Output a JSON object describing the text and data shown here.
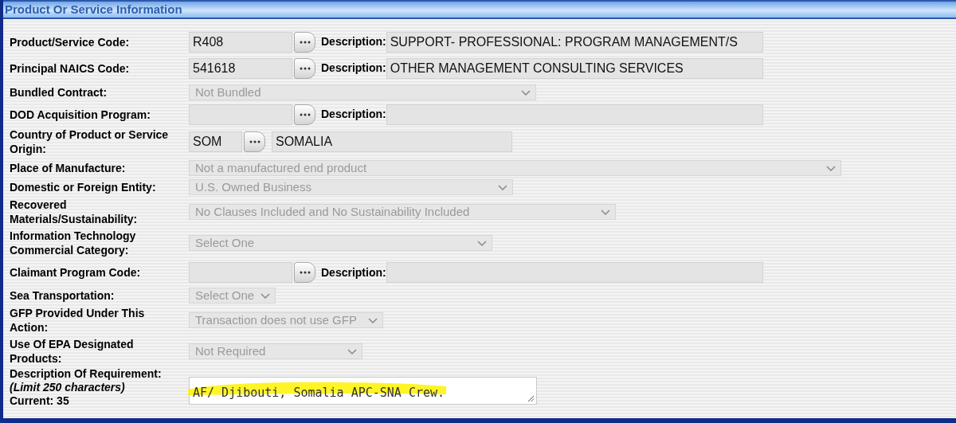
{
  "section": {
    "title": "Product Or Service Information"
  },
  "rows": [
    {
      "kind": "lookup",
      "label": "Product/Service Code:",
      "code": "R408",
      "description_label": "Description:",
      "description": "SUPPORT- PROFESSIONAL: PROGRAM MANAGEMENT/S"
    },
    {
      "kind": "lookup",
      "label": "Principal NAICS Code:",
      "code": "541618",
      "description_label": "Description:",
      "description": "OTHER MANAGEMENT CONSULTING SERVICES"
    },
    {
      "kind": "select",
      "label": "Bundled Contract:",
      "value": "Not Bundled",
      "disabled": true
    },
    {
      "kind": "lookup",
      "label": "DOD Acquisition Program:",
      "description_label": "Description:"
    },
    {
      "kind": "country",
      "label": "Country of Product or Service Origin:",
      "code": "SOM",
      "description": "SOMALIA"
    },
    {
      "kind": "select",
      "label": "Place of Manufacture:",
      "value": "Not a manufactured end product",
      "disabled": true
    },
    {
      "kind": "select",
      "label": "Domestic or Foreign Entity:",
      "value": "U.S. Owned Business",
      "disabled": true
    },
    {
      "kind": "select",
      "label": "Recovered Materials/Sustainability:",
      "value": "No Clauses Included and No Sustainability Included",
      "disabled": true
    },
    {
      "kind": "select",
      "label": "Information Technology Commercial Category:",
      "value": "Select One",
      "disabled": true
    },
    {
      "kind": "lookup",
      "label": "Claimant Program Code:",
      "description_label": "Description:"
    },
    {
      "kind": "select",
      "label": "Sea Transportation:",
      "value": "Select One",
      "disabled": true
    },
    {
      "kind": "select",
      "label": "GFP Provided Under This Action:",
      "value": "Transaction does not use GFP",
      "disabled": true
    },
    {
      "kind": "select",
      "label": "Use Of EPA Designated Products:",
      "value": "Not Required",
      "disabled": true
    },
    {
      "kind": "textarea",
      "label": "Description Of Requirement:",
      "note": "(Limit 250 characters)",
      "counter": "Current: 35",
      "value": "AF/ Djibouti, Somalia APC-SNA Crew.",
      "highlighted": true
    }
  ]
}
